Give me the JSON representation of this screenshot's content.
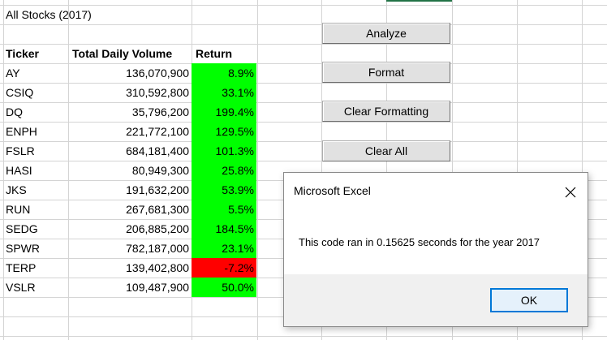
{
  "sheet": {
    "title": "All Stocks (2017)",
    "headers": {
      "ticker": "Ticker",
      "volume": "Total Daily Volume",
      "return": "Return"
    },
    "rows": [
      {
        "ticker": "AY",
        "volume": "136,070,900",
        "return": "8.9%",
        "status": "positive"
      },
      {
        "ticker": "CSIQ",
        "volume": "310,592,800",
        "return": "33.1%",
        "status": "positive"
      },
      {
        "ticker": "DQ",
        "volume": "35,796,200",
        "return": "199.4%",
        "status": "positive"
      },
      {
        "ticker": "ENPH",
        "volume": "221,772,100",
        "return": "129.5%",
        "status": "positive"
      },
      {
        "ticker": "FSLR",
        "volume": "684,181,400",
        "return": "101.3%",
        "status": "positive"
      },
      {
        "ticker": "HASI",
        "volume": "80,949,300",
        "return": "25.8%",
        "status": "positive"
      },
      {
        "ticker": "JKS",
        "volume": "191,632,200",
        "return": "53.9%",
        "status": "positive"
      },
      {
        "ticker": "RUN",
        "volume": "267,681,300",
        "return": "5.5%",
        "status": "positive"
      },
      {
        "ticker": "SEDG",
        "volume": "206,885,200",
        "return": "184.5%",
        "status": "positive"
      },
      {
        "ticker": "SPWR",
        "volume": "782,187,000",
        "return": "23.1%",
        "status": "positive"
      },
      {
        "ticker": "TERP",
        "volume": "139,402,800",
        "return": "-7.2%",
        "status": "negative"
      },
      {
        "ticker": "VSLR",
        "volume": "109,487,900",
        "return": "50.0%",
        "status": "positive"
      }
    ],
    "colors": {
      "positive": "#00ff00",
      "negative": "#ff0000",
      "grid": "#d4d4d4"
    }
  },
  "buttons": {
    "analyze": "Analyze",
    "format": "Format",
    "clear_formatting": "Clear Formatting",
    "clear_all": "Clear All"
  },
  "dialog": {
    "title": "Microsoft Excel",
    "message": "This code ran in 0.15625 seconds for the year 2017",
    "ok_label": "OK",
    "close_icon": "close-icon",
    "accent": "#0078d7"
  }
}
